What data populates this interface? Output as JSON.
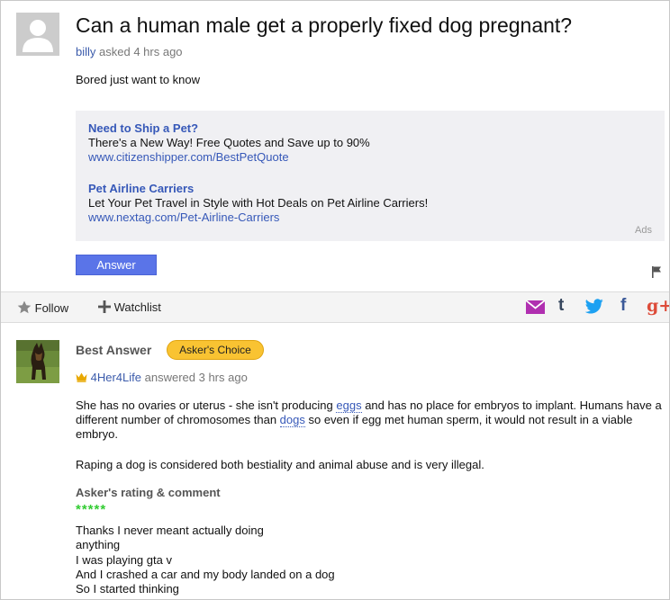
{
  "question": {
    "title": "Can a human male get a properly fixed dog pregnant?",
    "user": "billy",
    "asked_text": "asked 4 hrs ago",
    "body": "Bored just want to know"
  },
  "ads": {
    "items": [
      {
        "title": "Need to Ship a Pet?",
        "desc": "There's a New Way! Free Quotes and Save up to 90%",
        "url": "www.citizenshipper.com/BestPetQuote"
      },
      {
        "title": "Pet Airline Carriers",
        "desc": "Let Your Pet Travel in Style with Hot Deals on Pet Airline Carriers!",
        "url": "www.nextag.com/Pet-Airline-Carriers"
      }
    ],
    "label": "Ads"
  },
  "answer_button": "Answer",
  "toolbar": {
    "follow": "Follow",
    "watchlist": "Watchlist",
    "share": {
      "tumblr": "t",
      "facebook": "f",
      "google": "g+"
    }
  },
  "best_answer": {
    "label": "Best Answer",
    "badge": "Asker's Choice",
    "user": "4Her4Life",
    "answered_text": "answered 3 hrs ago",
    "para1_a": "She has no ovaries or uterus - she isn't producing ",
    "para1_link1": "eggs",
    "para1_b": " and has no place for embryos to implant. Humans have a different number of chromosomes than ",
    "para1_link2": "dogs",
    "para1_c": " so even if egg met human sperm, it would not result in a viable embryo.",
    "para2": "Raping a dog is considered both bestiality and animal abuse and is very illegal.",
    "rating_label": "Asker's rating & comment",
    "stars": "*****",
    "rating": 5,
    "comment_lines": [
      "Thanks I never meant actually doing",
      "anything",
      "I was playing gta v",
      "And I crashed a car and my body landed on a dog",
      "So I started thinking"
    ]
  },
  "colors": {
    "link": "#3658b8",
    "answer_button": "#5a74e8",
    "badge": "#f9c332",
    "stars": "#33cc33",
    "mail": "#b02fb0",
    "tumblr": "#36465d",
    "twitter": "#1da1f2",
    "facebook": "#3b5998",
    "google": "#dd4b39"
  }
}
